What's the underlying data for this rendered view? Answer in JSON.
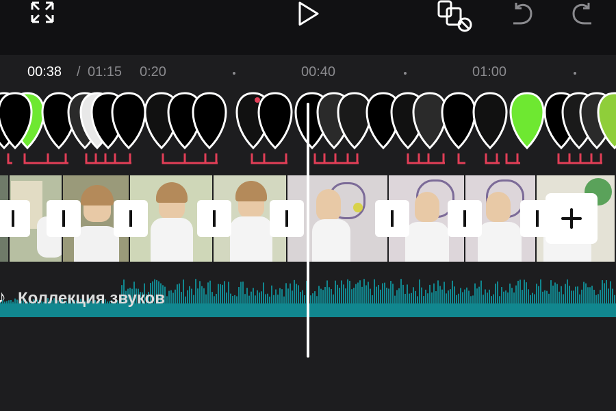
{
  "toolbar": {
    "icons": [
      "fullscreen-icon",
      "play-icon",
      "no-overlap-icon",
      "undo-icon",
      "redo-icon"
    ]
  },
  "timeline": {
    "current_time": "00:38",
    "separator": "/",
    "total_time": "01:15",
    "ticks": [
      "0:20",
      "00:40",
      "01:00"
    ]
  },
  "audio": {
    "label": "Коллекция звуков",
    "icon": "music-note-icon",
    "waveform_color": "#11878f"
  },
  "colors": {
    "background": "#1d1d1f",
    "topbar": "#111113",
    "marker": "#e23e57",
    "accent_green": "#6ee831",
    "playhead": "#ffffff"
  }
}
